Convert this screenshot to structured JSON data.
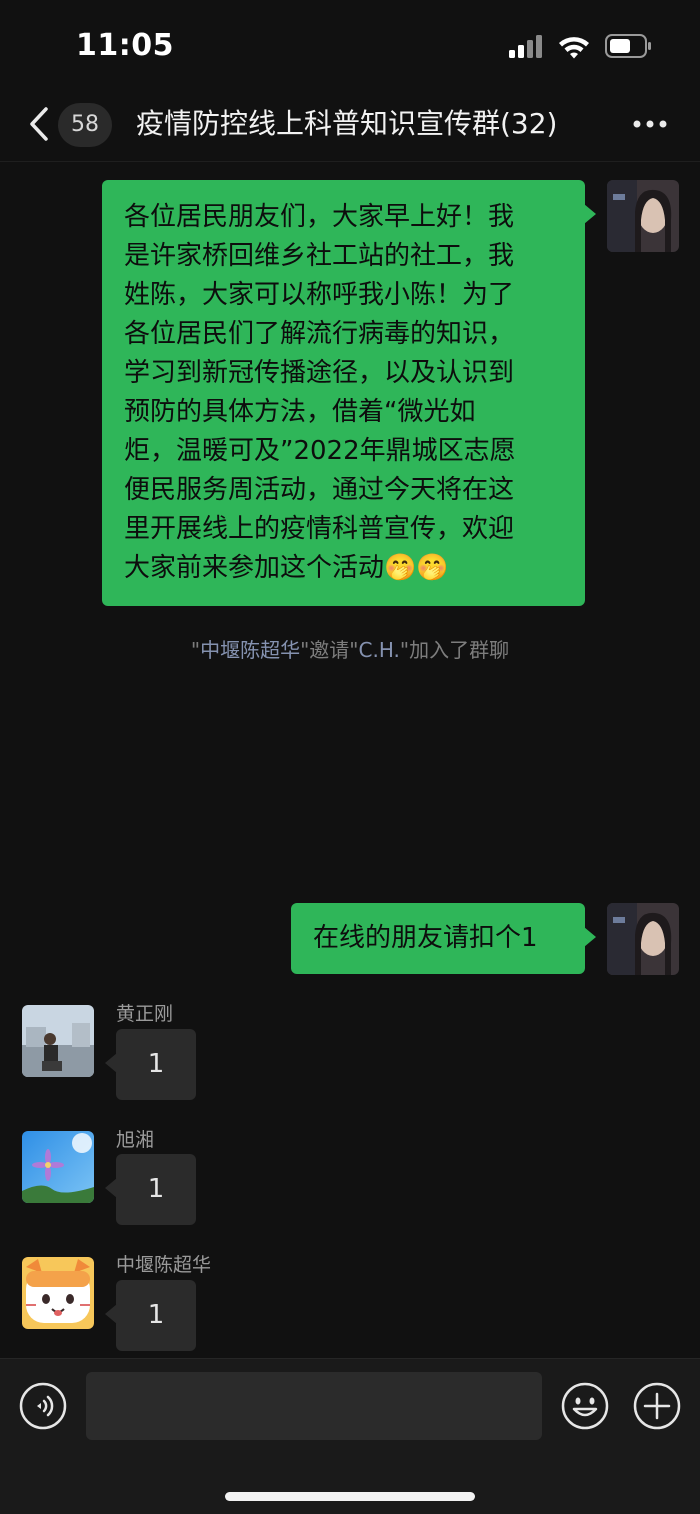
{
  "status_bar": {
    "time": "11:05",
    "icons": [
      "signal-icon",
      "wifi-icon",
      "battery-icon"
    ]
  },
  "nav": {
    "back_icon": "chevron-left-icon",
    "unread_count": "58",
    "title": "疫情防控线上科普知识宣传群(32)",
    "more_icon": "more-dots-icon"
  },
  "messages": [
    {
      "side": "out",
      "text": "各位居民朋友们，大家早上好！我是许家桥回维乡社工站的社工，我姓陈，大家可以称呼我小陈！为了各位居民们了解流行病毒的知识，学习到新冠传播途径，以及认识到预防的具体方法，借着“微光如炬，温暖可及”2022年鼎城区志愿便民服务周活动，通过今天将在这里开展线上的疫情科普宣传，欢迎大家前来参加这个活动🤭🤭",
      "lines": [
        "各位居民朋友们，大家早上好！我",
        "是许家桥回维乡社工站的社工，我",
        "姓陈，大家可以称呼我小陈！为了",
        "各位居民们了解流行病毒的知识，",
        "学习到新冠传播途径，以及认识到",
        "预防的具体方法，借着“微光如",
        "炬，温暖可及”2022年鼎城区志愿",
        "便民服务周活动，通过今天将在这",
        "里开展线上的疫情科普宣传，欢迎",
        "大家前来参加这个活动🤭🤭"
      ]
    },
    {
      "side": "system",
      "q1": "\"",
      "name1": "中堰陈超华",
      "q2": "\"邀请\"",
      "name2": "C.H.",
      "q3": "\"加入了群聊"
    },
    {
      "side": "out",
      "text": "在线的朋友请扣个1"
    },
    {
      "side": "in",
      "sender": "黄正刚",
      "text": "1"
    },
    {
      "side": "in",
      "sender": "旭湘",
      "text": "1"
    },
    {
      "side": "in",
      "sender": "中堰陈超华",
      "text": "1"
    }
  ],
  "input_bar": {
    "voice_icon": "voice-icon",
    "input_value": "",
    "emoji_icon": "emoji-icon",
    "plus_icon": "plus-icon"
  },
  "colors": {
    "background": "#111111",
    "bubble_out": "#2fb659",
    "bubble_in": "#2b2b2b",
    "system_highlight": "#8592b0"
  }
}
